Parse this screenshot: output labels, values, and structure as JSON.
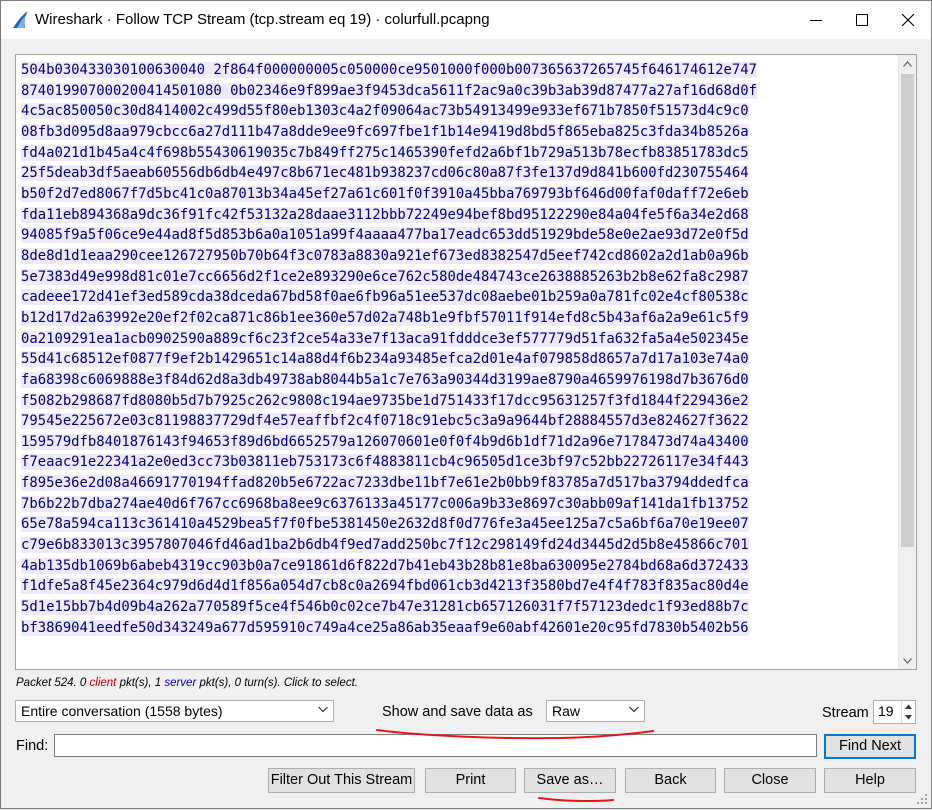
{
  "window": {
    "title": "Wireshark · Follow TCP Stream (tcp.stream eq 19) · colurfull.pcapng",
    "accent": "#0f6bb8"
  },
  "stream": {
    "text_color": "#00007f",
    "highlight_color": "#edebfb",
    "lines": [
      "504b030433030100630040 2f864f000000005c050000ce9501000f000b007365637265745f646174612e747",
      "874019907000200414501080 0b02346e9f899ae3f9453dca5611f2ac9a0c39b3ab39d87477a27af16d68d0f",
      "4c5ac850050c30d8414002c499d55f80eb1303c4a2f09064ac73b54913499e933ef671b7850f51573d4c9c0",
      "08fb3d095d8aa979cbcc6a27d111b47a8dde9ee9fc697fbe1f1b14e9419d8bd5f865eba825c3fda34b8526a",
      "fd4a021d1b45a4c4f698b55430619035c7b849ff275c1465390fefd2a6bf1b729a513b78ecfb83851783dc5",
      "25f5deab3df5aeab60556db6db4e497c8b671ec481b938237cd06c80a87f3fe137d9d841b600fd230755464",
      "b50f2d7ed8067f7d5bc41c0a87013b34a45ef27a61c601f0f3910a45bba769793bf646d00faf0daff72e6eb",
      "fda11eb894368a9dc36f91fc42f53132a28daae3112bbb72249e94bef8bd95122290e84a04fe5f6a34e2d68",
      "94085f9a5f06ce9e44ad8f5d853b6a0a1051a99f4aaaa477ba17eadc653dd51929bde58e0e2ae93d72e0f5d",
      "8de8d1d1eaa290cee126727950b70b64f3c0783a8830a921ef673ed8382547d5eef742cd8602a2d1ab0a96b",
      "5e7383d49e998d81c01e7cc6656d2f1ce2e893290e6ce762c580de484743ce2638885263b2b8e62fa8c2987",
      "cadeee172d41ef3ed589cda38dceda67bd58f0ae6fb96a51ee537dc08aebe01b259a0a781fc02e4cf80538c",
      "b12d17d2a63992e20ef2f02ca871c86b1ee360e57d02a748b1e9fbf57011f914efd8c5b43af6a2a9e61c5f9",
      "0a2109291ea1acb0902590a889cf6c23f2ce54a33e7f13aca91fdddce3ef577779d51fa632fa5a4e502345e",
      "55d41c68512ef0877f9ef2b1429651c14a88d4f6b234a93485efca2d01e4af079858d8657a7d17a103e74a0",
      "fa68398c6069888e3f84d62d8a3db49738ab8044b5a1c7e763a90344d3199ae8790a4659976198d7b3676d0",
      "f5082b298687fd8080b5d7b7925c262c9808c194ae9735be1d751433f17dcc95631257f3fd1844f229436e2",
      "79545e225672e03c81198837729df4e57eaffbf2c4f0718c91ebc5c3a9a9644bf28884557d3e824627f3622",
      "159579dfb8401876143f94653f89d6bd6652579a126070601e0f0f4b9d6b1df71d2a96e7178473d74a43400",
      "f7eaac91e22341a2e0ed3cc73b03811eb753173c6f4883811cb4c96505d1ce3bf97c52bb22726117e34f443",
      "f895e36e2d08a46691770194ffad820b5e6722ac7233dbe11bf7e61e2b0bb9f83785a7d517ba3794ddedfca",
      "7b6b22b7dba274ae40d6f767cc6968ba8ee9c6376133a45177c006a9b33e8697c30abb09af141da1fb13752",
      "65e78a594ca113c361410a4529bea5f7f0fbe5381450e2632d8f0d776fe3a45ee125a7c5a6bf6a70e19ee07",
      "c79e6b833013c3957807046fd46ad1ba2b6db4f9ed7add250bc7f12c298149fd24d3445d2d5b8e45866c701",
      "4ab135db1069b6abeb4319cc903b0a7ce91861d6f822d7b41eb43b28b81e8ba630095e2784bd68a6d372433",
      "f1dfe5a8f45e2364c979d6d4d1f856a054d7cb8c0a2694fbd061cb3d4213f3580bd7e4f4f783f835ac80d4e",
      "5d1e15bb7b4d09b4a262a770589f5ce4f546b0c02ce7b47e31281cb657126031f7f57123dedc1f93ed88b7c",
      "bf3869041eedfe50d343249a677d595910c749a4ce25a86ab35eaaf9e60abf42601e20c95fd7830b5402b56"
    ]
  },
  "status": {
    "prefix": "Packet 524. 0 ",
    "client": "client",
    "mid1": " pkt(s), 1 ",
    "server": "server",
    "suffix": " pkt(s), 0 turn(s). Click to select.",
    "client_color": "#c00000",
    "server_color": "#0000c0"
  },
  "controls": {
    "conversation": "Entire conversation (1558 bytes)",
    "show_as_label": "Show and save data as",
    "show_as_value": "Raw",
    "stream_label": "Stream",
    "stream_value": "19",
    "find_label": "Find:",
    "find_value": "",
    "find_next": "Find Next"
  },
  "buttons": {
    "filter_out": "Filter Out This Stream",
    "print": "Print",
    "save_as": "Save as…",
    "back": "Back",
    "close": "Close",
    "help": "Help"
  },
  "annotation_color": "#e8141d"
}
